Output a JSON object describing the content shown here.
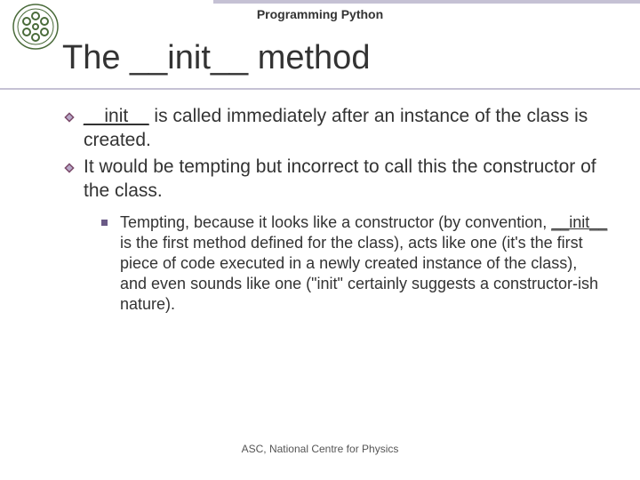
{
  "header": {
    "course_title": "Programming Python"
  },
  "slide": {
    "title": "The __init__ method"
  },
  "bullets": {
    "b1_underlined": "__init__",
    "b1_rest": " is called immediately after an instance of the class is created.",
    "b2": "It would be tempting but incorrect to call this the constructor of the class.",
    "sub1_a": "Tempting, because it looks like a constructor (by convention, ",
    "sub1_u": "__init__",
    "sub1_b": " is the first method defined for the class), acts like one (it's the first piece of code executed in a newly created instance of the class), and even sounds like one (\"init\" certainly suggests a constructor-ish nature)."
  },
  "footer": {
    "text": "ASC, National Centre for Physics"
  }
}
